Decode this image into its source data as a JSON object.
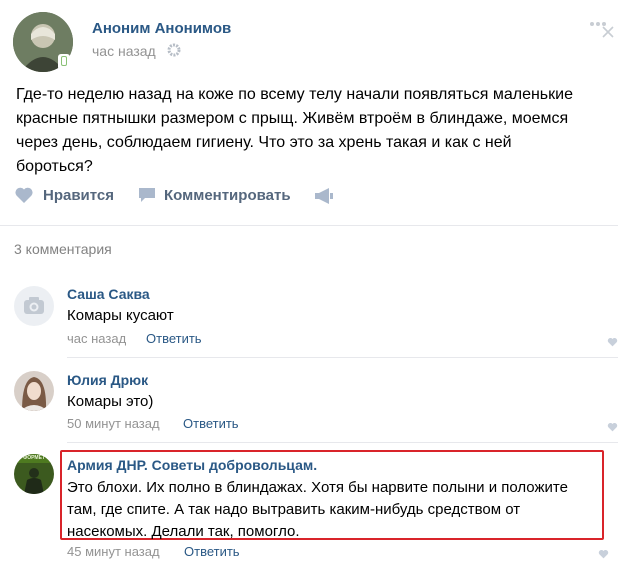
{
  "post": {
    "author": "Аноним Анонимов",
    "time": "час назад",
    "text": "Где-то неделю назад на коже по всему телу начали появляться маленькие красные пятнышки размером с прыщ. Живём втроём в блиндаже, моемся через день, соблюдаем гигиену. Что это за хрень такая и как с ней бороться?",
    "like_label": "Нравится",
    "comment_label": "Комментировать"
  },
  "comments_header": "3 комментария",
  "comments": [
    {
      "author": "Саша Саква",
      "text": "Комары кусают",
      "time": "час назад",
      "reply": "Ответить"
    },
    {
      "author": "Юлия Дрюк",
      "text": "Комары это)",
      "time": "50 минут назад",
      "reply": "Ответить"
    },
    {
      "author": "Армия ДНР. Советы добровольцам.",
      "text": "Это блохи. Их полно в блиндажах. Хотя бы нарвите полыни и положите там, где спите. А так надо вытравить каким-нибудь средством от насекомых. Делали так, помогло.",
      "time": "45 минут назад",
      "reply": "Ответить",
      "avatar_text": "ФОРМЕТ"
    }
  ],
  "colors": {
    "link": "#2a5885",
    "highlight_border": "#d9242a",
    "gray": "#939393",
    "icon": "#aab8cc"
  }
}
